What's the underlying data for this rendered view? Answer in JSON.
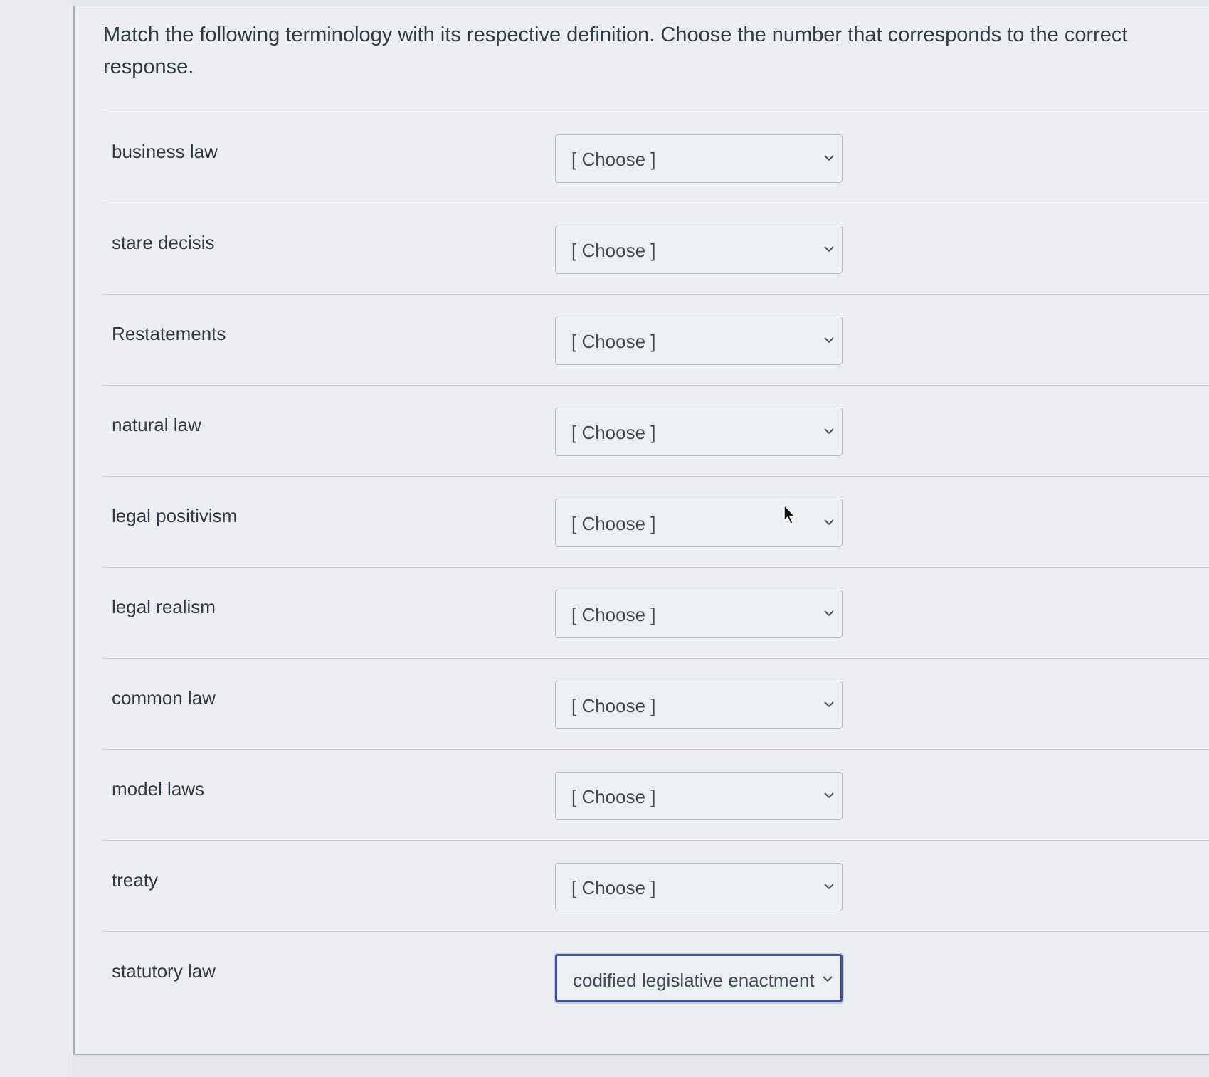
{
  "prompt": "Match the following terminology with its respective definition.  Choose the number that corresponds to the correct response.",
  "chevron_icon": "chevron-down-icon",
  "rows": [
    {
      "term": "business law",
      "selected": "[ Choose ]"
    },
    {
      "term": "stare decisis",
      "selected": "[ Choose ]"
    },
    {
      "term": "Restatements",
      "selected": "[ Choose ]"
    },
    {
      "term": "natural law",
      "selected": "[ Choose ]"
    },
    {
      "term": "legal positivism",
      "selected": "[ Choose ]"
    },
    {
      "term": "legal realism",
      "selected": "[ Choose ]"
    },
    {
      "term": "common law",
      "selected": "[ Choose ]"
    },
    {
      "term": "model laws",
      "selected": "[ Choose ]"
    },
    {
      "term": "treaty",
      "selected": "[ Choose ]"
    },
    {
      "term": "statutory law",
      "selected": "codified legislative enactment"
    }
  ],
  "colors": {
    "text": "#2d3b45",
    "focus_border": "#3d4fa0"
  }
}
